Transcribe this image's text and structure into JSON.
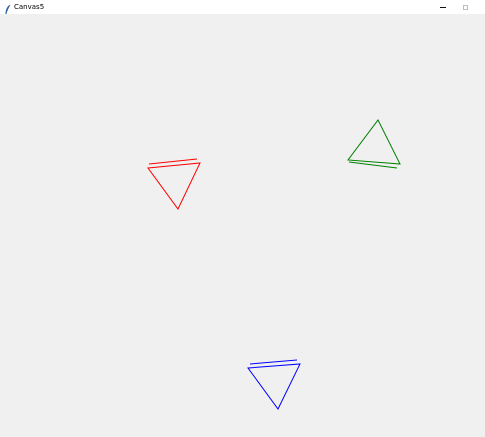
{
  "window": {
    "title": "Canvas5",
    "icon": "feather-icon",
    "controls": [
      "minimize-icon",
      "maximize-icon"
    ]
  },
  "canvas": {
    "background": "#f0f0f0",
    "shapes": [
      {
        "name": "red-triangle",
        "color": "#ff0000"
      },
      {
        "name": "green-triangle",
        "color": "#008000"
      },
      {
        "name": "blue-triangle",
        "color": "#0000ff"
      }
    ]
  }
}
